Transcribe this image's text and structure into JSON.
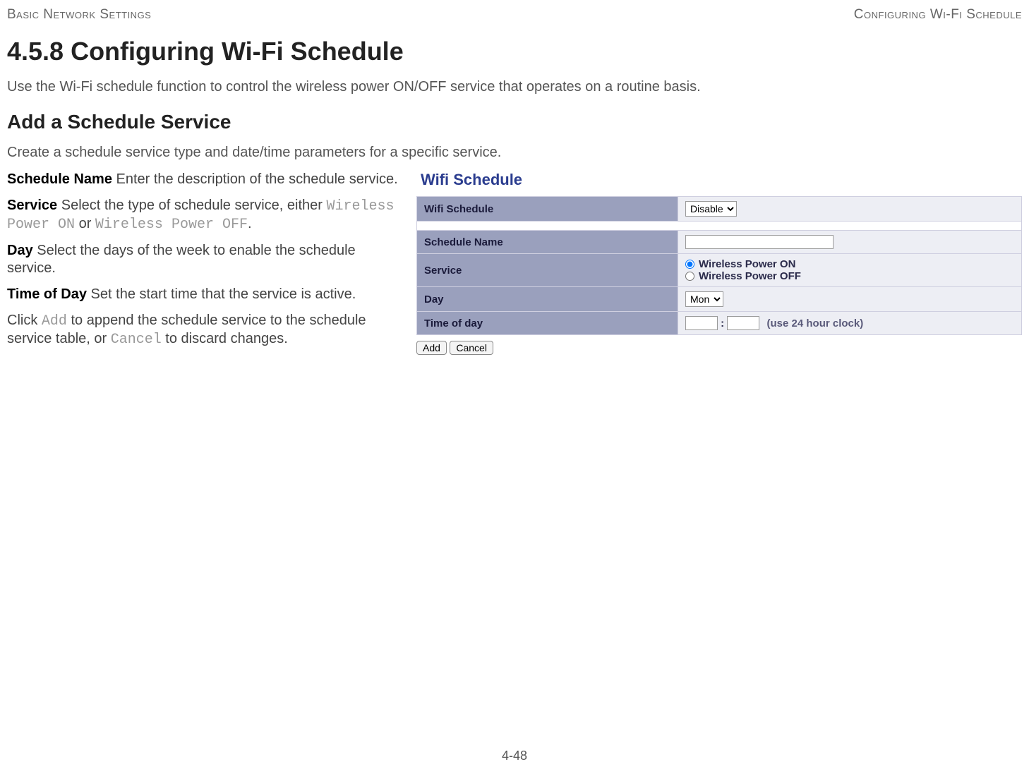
{
  "header": {
    "left": "Basic Network Settings",
    "right": "Configuring Wi-Fi Schedule"
  },
  "section_title": "4.5.8 Configuring Wi-Fi Schedule",
  "intro": "Use the Wi-Fi schedule function to control the wireless power ON/OFF service that operates on a routine basis.",
  "subheading": "Add a Schedule Service",
  "subintro": "Create a schedule service type and date/time parameters for a specific service.",
  "defs": {
    "schedule_name": {
      "term": "Schedule Name",
      "text_after": " Enter the description of the schedule service."
    },
    "service": {
      "term": "Service",
      "text_before": " Select the type of schedule service, either ",
      "opt1": "Wireless Power ON",
      "joiner": " or ",
      "opt2": "Wireless Power OFF",
      "period": "."
    },
    "day": {
      "term": "Day",
      "text_after": " Select the days of the week to enable the schedule service."
    },
    "time": {
      "term": "Time of Day",
      "text_after": " Set the start time that the service is active."
    },
    "click": {
      "pre": "Click ",
      "add": "Add",
      "mid": " to append the schedule service to the schedule service table, or ",
      "cancel": "Cancel",
      "post": " to discard changes."
    }
  },
  "panel": {
    "title": "Wifi Schedule",
    "rows": {
      "wifi_schedule": {
        "label": "Wifi Schedule",
        "value": "Disable"
      },
      "schedule_name": {
        "label": "Schedule Name",
        "value": ""
      },
      "service": {
        "label": "Service",
        "opt_on": "Wireless Power ON",
        "opt_off": "Wireless Power OFF"
      },
      "day": {
        "label": "Day",
        "value": "Mon"
      },
      "time": {
        "label": "Time of day",
        "hh": "",
        "mm": "",
        "hint": "(use 24 hour clock)",
        "colon": ":"
      }
    },
    "buttons": {
      "add": "Add",
      "cancel": "Cancel"
    }
  },
  "footer": {
    "page": "4-48"
  }
}
